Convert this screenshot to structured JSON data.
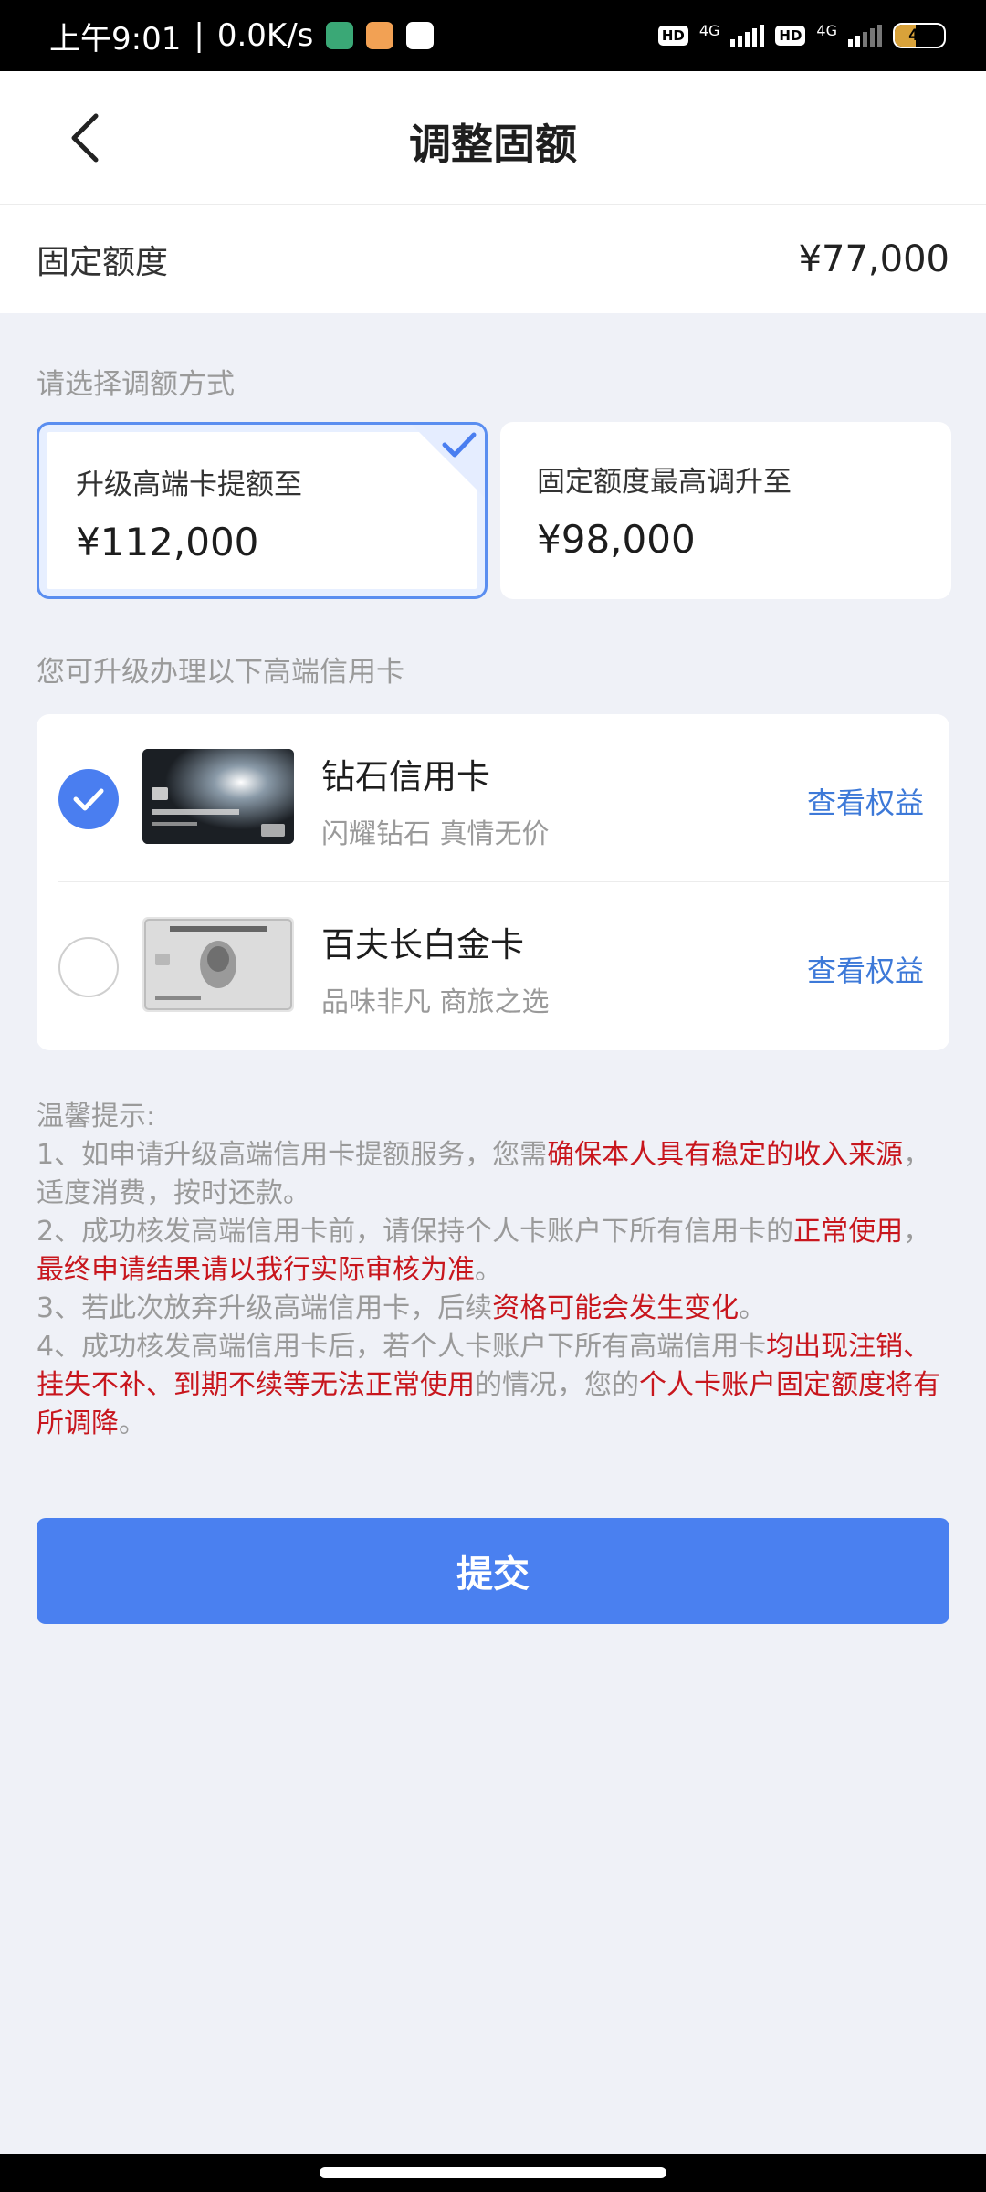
{
  "status_bar": {
    "time": "上午9:01",
    "speed": "0.0K/s",
    "hd1": "HD",
    "net1": "4G",
    "hd2": "HD",
    "net2": "4G",
    "battery": "43"
  },
  "nav": {
    "back_icon": "chevron-left-icon",
    "title": "调整固额"
  },
  "fixed_limit": {
    "label": "固定额度",
    "value": "¥77,000"
  },
  "adjust_section": {
    "label": "请选择调额方式",
    "options": [
      {
        "title": "升级高端卡提额至",
        "value": "¥112,000",
        "selected": true
      },
      {
        "title": "固定额度最高调升至",
        "value": "¥98,000",
        "selected": false
      }
    ]
  },
  "cards_section": {
    "label": "您可升级办理以下高端信用卡",
    "cards": [
      {
        "name": "钻石信用卡",
        "desc": "闪耀钻石 真情无价",
        "link": "查看权益",
        "selected": true
      },
      {
        "name": "百夫长白金卡",
        "desc": "品味非凡 商旅之选",
        "link": "查看权益",
        "selected": false
      }
    ]
  },
  "tips": {
    "heading": "温馨提示:",
    "t1a": "1、如申请升级高端信用卡提额服务，您需",
    "t1b": "确保本人具有稳定的收入来源",
    "t1c": "，适度消费，按时还款。",
    "t2a": "2、成功核发高端信用卡前，请保持个人卡账户下所有信用卡的",
    "t2b": "正常使用",
    "t2c": "，",
    "t2d": "最终申请结果请以我行实际审核为准",
    "t2e": "。",
    "t3a": "3、若此次放弃升级高端信用卡，后续",
    "t3b": "资格可能会发生变化",
    "t3c": "。",
    "t4a": "4、成功核发高端信用卡后，若个人卡账户下所有高端信用卡",
    "t4b": "均出现注销、挂失不补、到期不续等无法正常使用",
    "t4c": "的情况，您的",
    "t4d": "个人卡账户固定额度将有所调降",
    "t4e": "。"
  },
  "submit_label": "提交",
  "colors": {
    "accent": "#4a80f0",
    "link": "#3d79d8",
    "warning_red": "#c8161d",
    "background": "#eff1f7"
  }
}
